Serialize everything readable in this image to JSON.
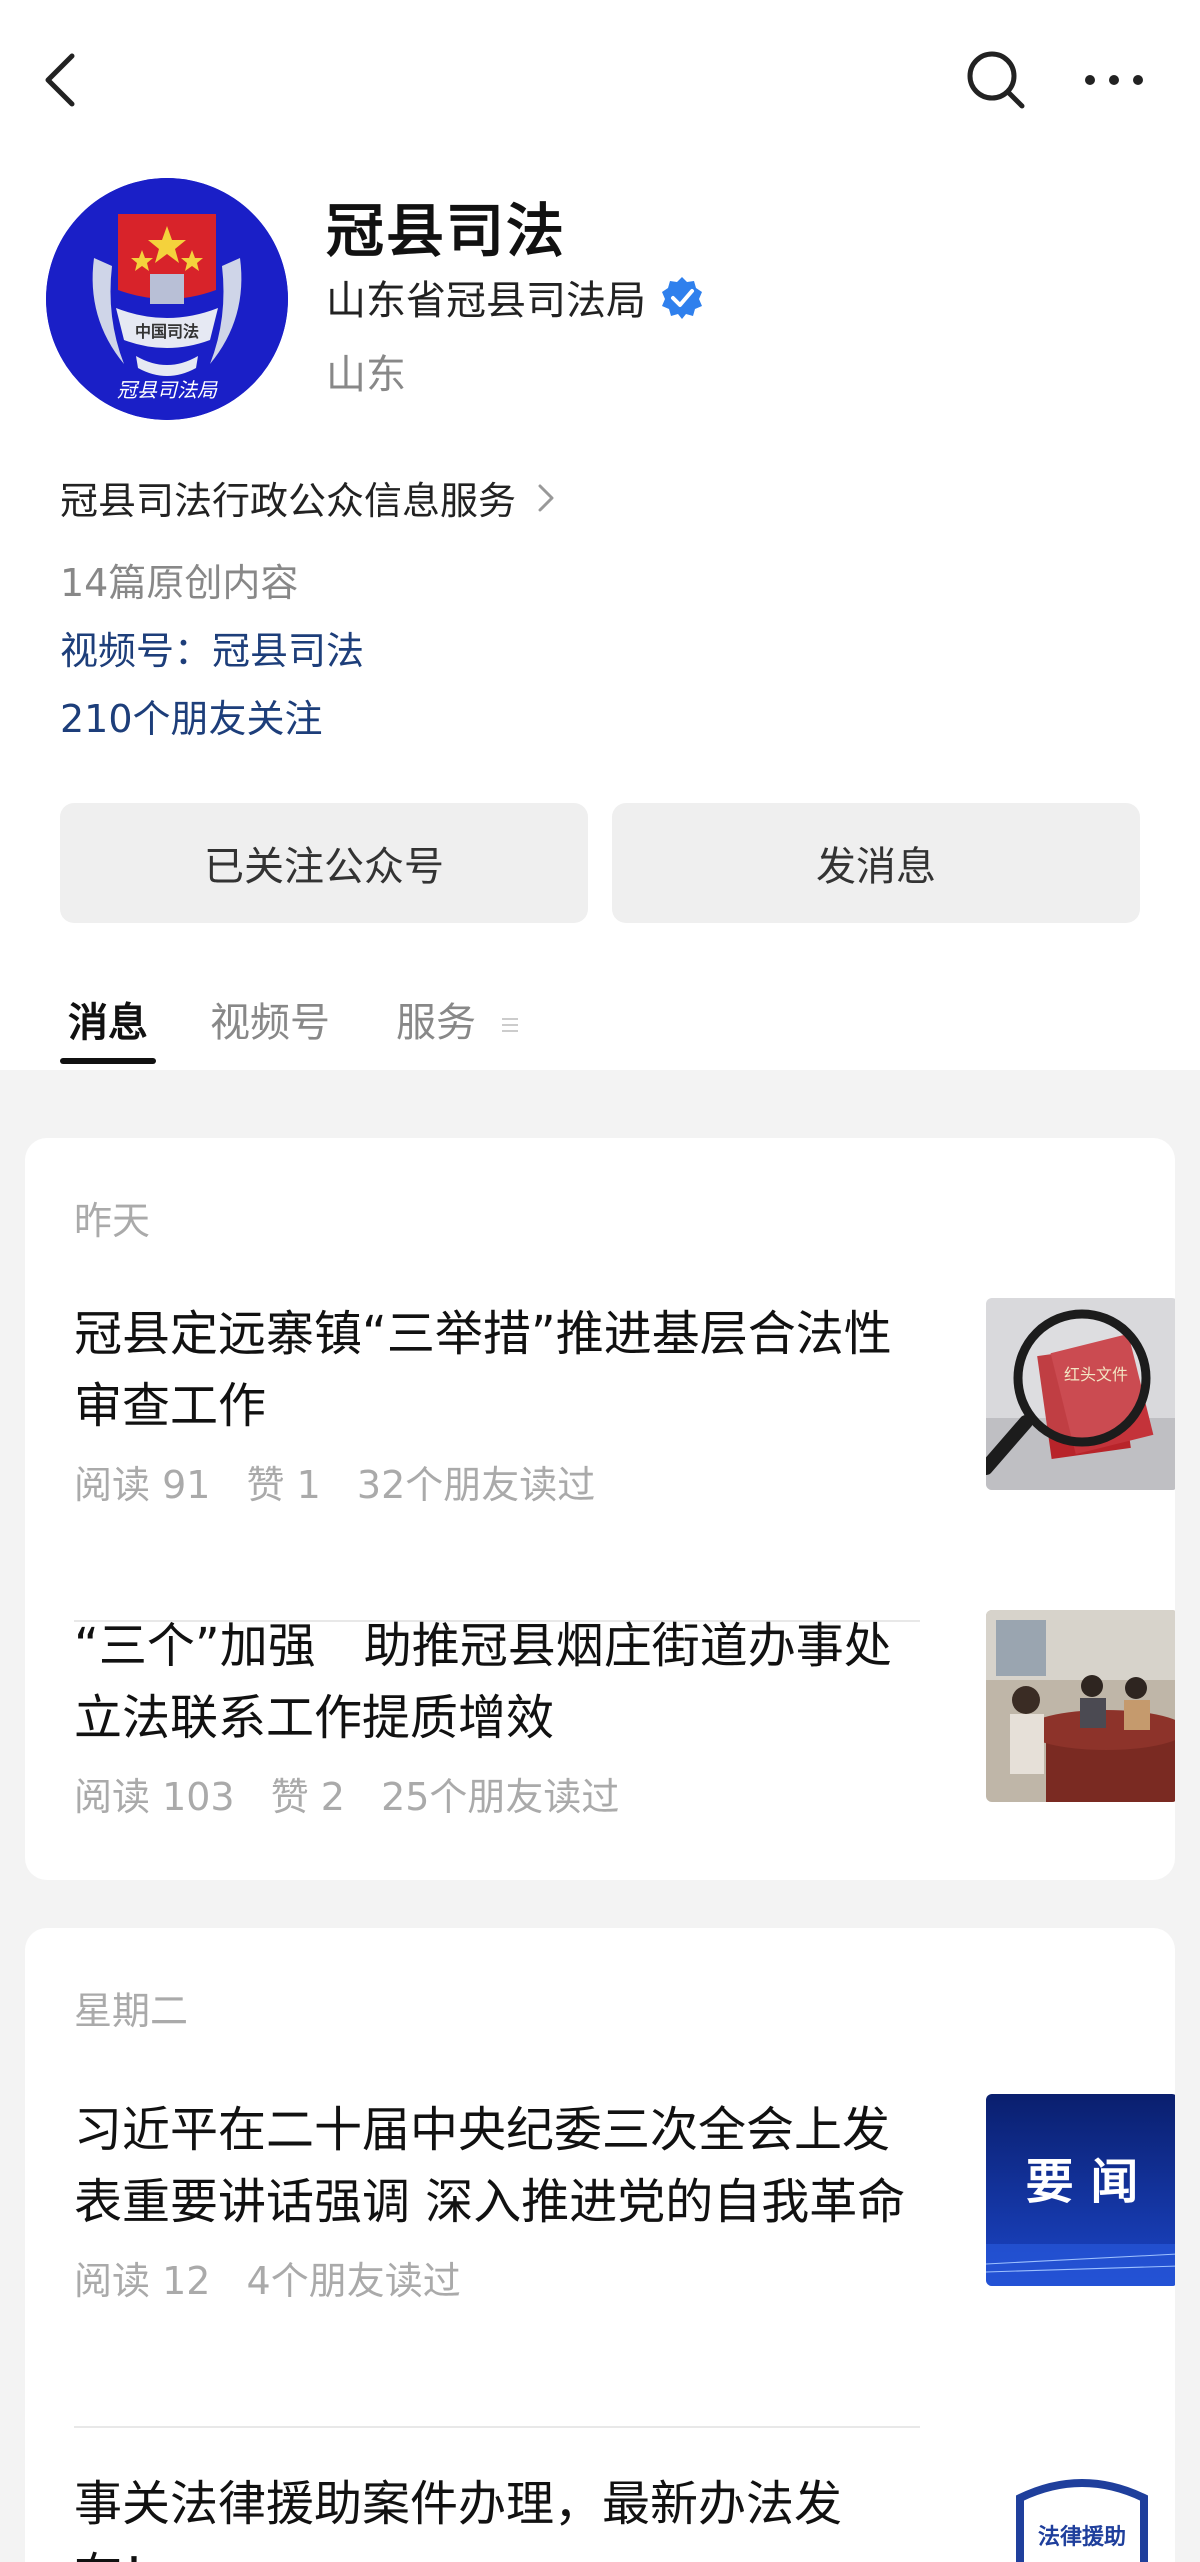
{
  "header": {
    "back_icon": "chevron-left-icon",
    "search_icon": "search-icon",
    "more_icon": "more-horizontal-icon"
  },
  "profile": {
    "name": "冠县司法",
    "org": "山东省冠县司法局",
    "region": "山东",
    "avatar_text": "冠县司法局",
    "avatar_badge": "中国司法",
    "avatar_color": "#1a1fc7",
    "verified_color": "#2f80ed"
  },
  "info": {
    "description": "冠县司法行政公众信息服务",
    "original_count": "14篇原创内容",
    "channel": "视频号：冠县司法",
    "friends_following": "210个朋友关注"
  },
  "actions": {
    "follow_label": "已关注公众号",
    "message_label": "发消息"
  },
  "tabs": [
    {
      "label": "消息"
    },
    {
      "label": "视频号"
    },
    {
      "label": "服务"
    }
  ],
  "groups": [
    {
      "date": "昨天",
      "articles": [
        {
          "title": "冠县定远寨镇“三举措”推进基层合法性审查工作",
          "reads": "阅读 91",
          "likes": "赞 1",
          "friends_read": "32个朋友读过",
          "thumb_text": "红头文件"
        },
        {
          "title": "“三个”加强　助推冠县烟庄街道办事处立法联系工作提质增效",
          "reads": "阅读 103",
          "likes": "赞 2",
          "friends_read": "25个朋友读过"
        }
      ]
    },
    {
      "date": "星期二",
      "articles": [
        {
          "title": "习近平在二十届中央纪委三次全会上发表重要讲话强调 深入推进党的自我革命",
          "reads": "阅读 12",
          "friends_read": "4个朋友读过",
          "thumb_text": "要 闻"
        },
        {
          "title": "事关法律援助案件办理，最新办法发布！",
          "thumb_text": "法律援助"
        }
      ]
    }
  ],
  "colors": {
    "link": "#1d3e7a",
    "muted": "#888888",
    "feed_bg": "#f3f3f3"
  }
}
